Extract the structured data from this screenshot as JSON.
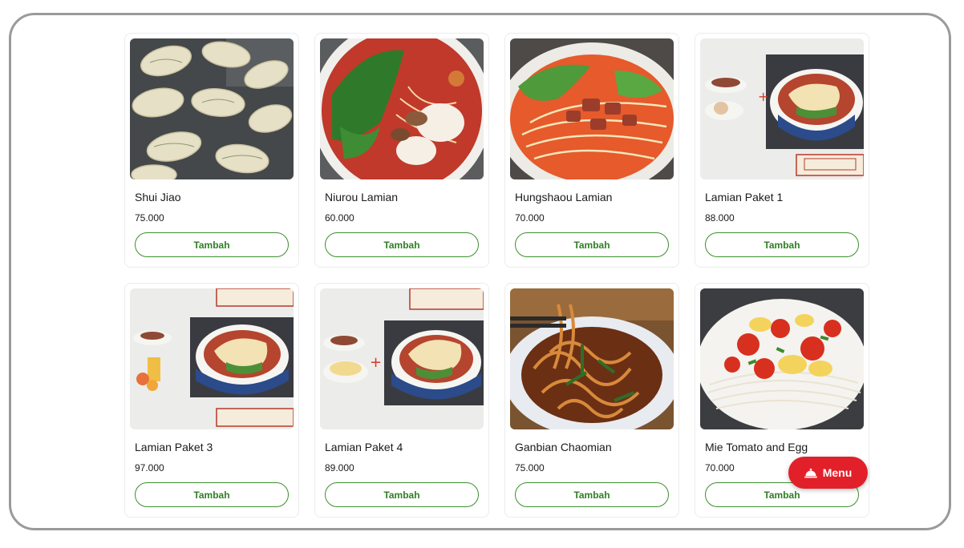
{
  "menu_items": [
    {
      "name": "Shui Jiao",
      "price": "75.000",
      "button": "Tambah",
      "image": "dumplings"
    },
    {
      "name": "Niurou Lamian",
      "price": "60.000",
      "button": "Tambah",
      "image": "beef-noodle-soup"
    },
    {
      "name": "Hungshaou Lamian",
      "price": "70.000",
      "button": "Tambah",
      "image": "braised-beef-noodle-soup"
    },
    {
      "name": "Lamian Paket 1",
      "price": "88.000",
      "button": "Tambah",
      "image": "noodle-package-menu-card"
    },
    {
      "name": "Lamian Paket 3",
      "price": "97.000",
      "button": "Tambah",
      "image": "noodle-package-menu-card"
    },
    {
      "name": "Lamian Paket 4",
      "price": "89.000",
      "button": "Tambah",
      "image": "noodle-package-menu-card"
    },
    {
      "name": "Ganbian Chaomian",
      "price": "75.000",
      "button": "Tambah",
      "image": "fried-noodles"
    },
    {
      "name": "Mie Tomato and Egg",
      "price": "70.000",
      "button": "Tambah",
      "image": "tomato-egg-noodles"
    }
  ],
  "menu_button": {
    "label": "Menu",
    "icon": "cloche-icon"
  },
  "colors": {
    "accent_green": "#2f7d24",
    "menu_red": "#e2202a",
    "frame_border": "#9a9a9a"
  }
}
